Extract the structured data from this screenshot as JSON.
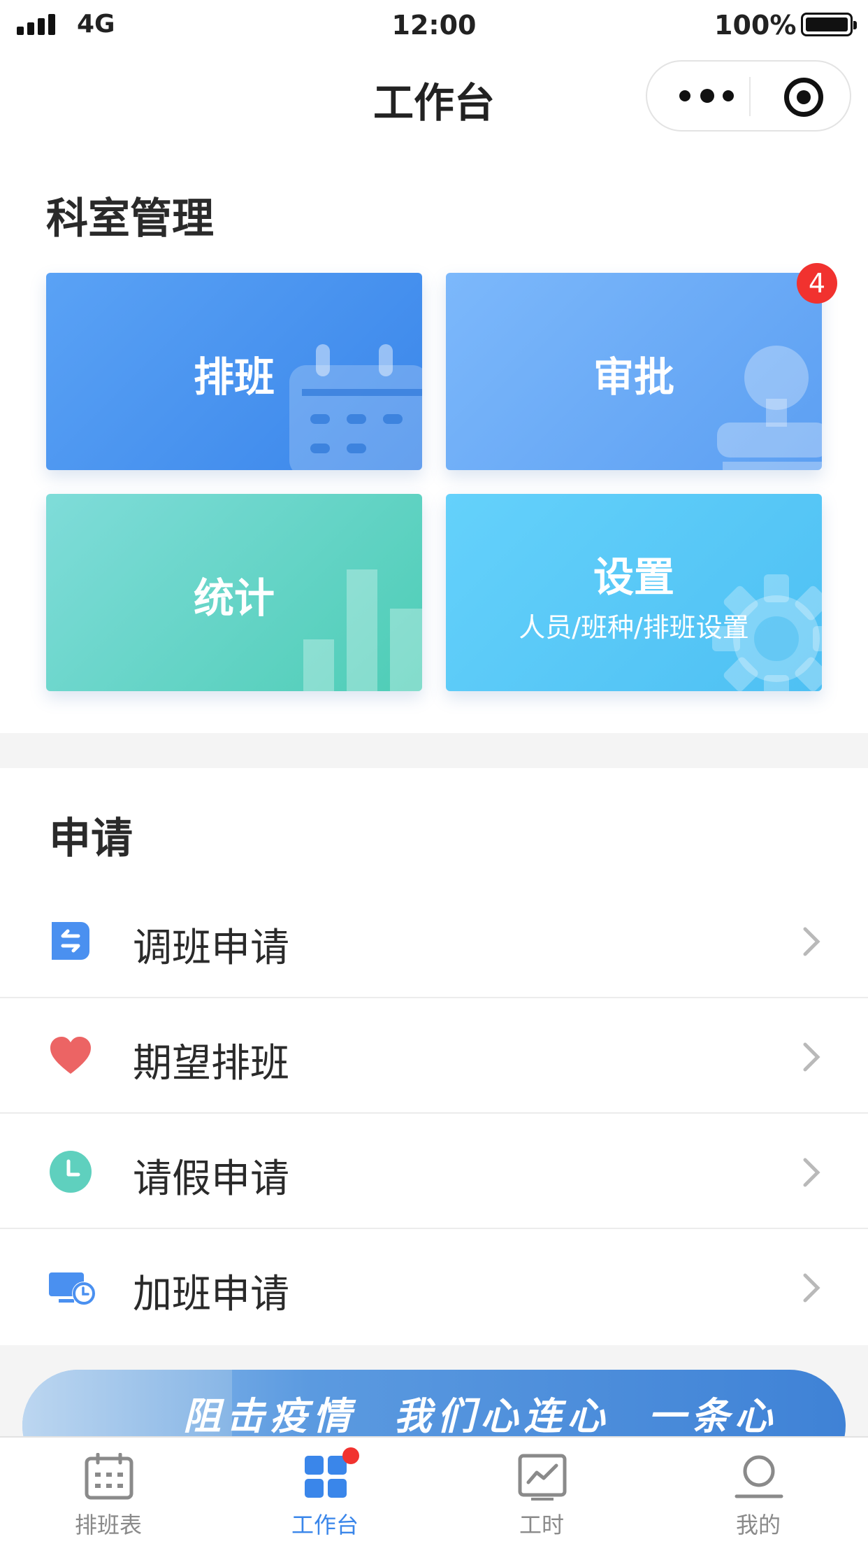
{
  "status_bar": {
    "network": "4G",
    "time": "12:00",
    "battery": "100%"
  },
  "nav": {
    "title": "工作台"
  },
  "dept": {
    "title": "科室管理",
    "cards": [
      {
        "label": "排班"
      },
      {
        "label": "审批",
        "badge": "4"
      },
      {
        "label": "统计"
      },
      {
        "label": "设置",
        "sub": "人员/班种/排班设置"
      }
    ]
  },
  "apply": {
    "title": "申请",
    "items": [
      {
        "label": "调班申请",
        "icon": "swap-icon"
      },
      {
        "label": "期望排班",
        "icon": "heart-icon"
      },
      {
        "label": "请假申请",
        "icon": "clock-icon"
      },
      {
        "label": "加班申请",
        "icon": "monitor-clock-icon"
      }
    ]
  },
  "banner": {
    "slogan": "阻击疫情  我们心连心  一条心"
  },
  "tabbar": {
    "tabs": [
      {
        "label": "排班表",
        "icon": "calendar-icon"
      },
      {
        "label": "工作台",
        "icon": "grid-icon"
      },
      {
        "label": "工时",
        "icon": "chart-icon"
      },
      {
        "label": "我的",
        "icon": "person-icon"
      }
    ],
    "active_index": 1
  },
  "colors": {
    "accent": "#3a86ea",
    "badge": "#f1322f",
    "heart": "#ec6464",
    "clock": "#5fd0be"
  }
}
